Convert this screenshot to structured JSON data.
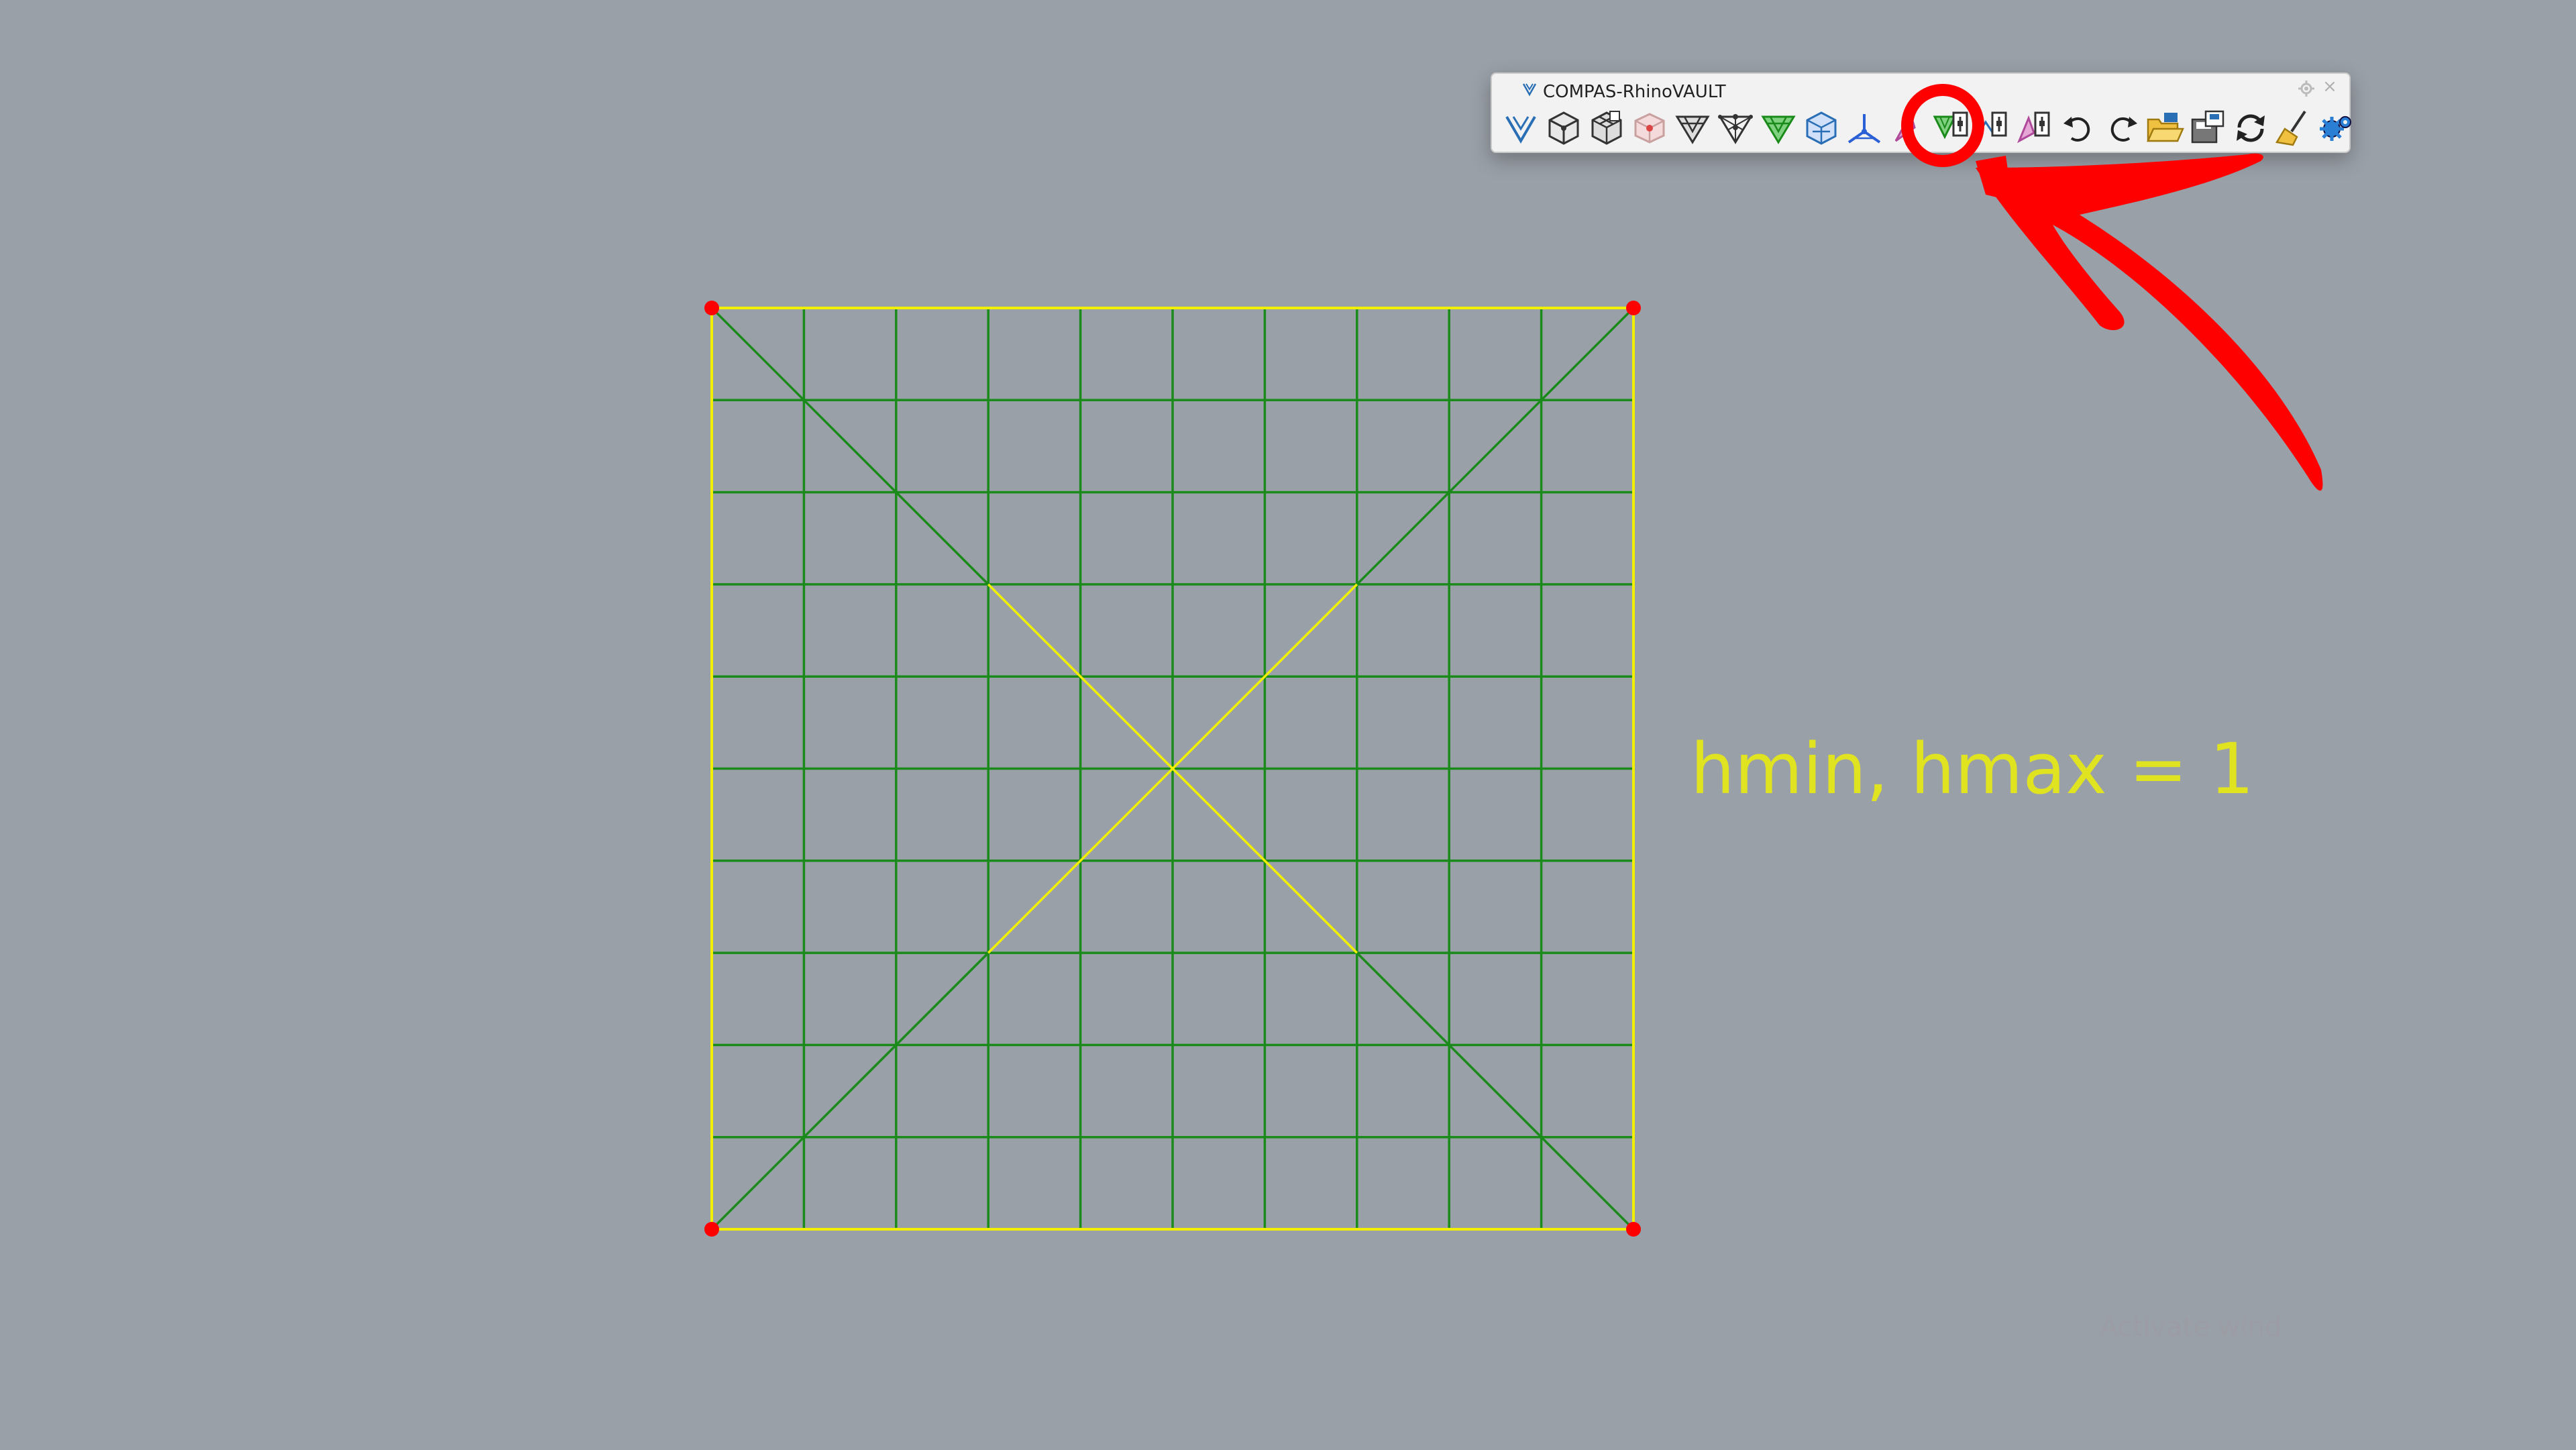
{
  "toolbar": {
    "title": "COMPAS-RhinoVAULT",
    "close_glyph": "×",
    "tools": [
      {
        "name": "rhinovault-logo-tool",
        "icon": "vault-logo-icon"
      },
      {
        "name": "form-diagram-box-tool",
        "icon": "box-icon"
      },
      {
        "name": "form-diagram-box-grid-tool",
        "icon": "box-grid-icon"
      },
      {
        "name": "form-diagram-mesh-tool",
        "icon": "mesh-icon"
      },
      {
        "name": "form-triangle-tool",
        "icon": "triangle-icon"
      },
      {
        "name": "form-dots-tool",
        "icon": "triangle-dots-icon"
      },
      {
        "name": "form-green-triangle-tool",
        "icon": "green-triangle-icon"
      },
      {
        "name": "force-diagram-tool",
        "icon": "force-diagram-icon"
      },
      {
        "name": "thrust-diagram-tool",
        "icon": "thrust-diagram-icon"
      },
      {
        "name": "purple-tool",
        "icon": "purple-leaf-icon"
      },
      {
        "name": "modify-form-tool",
        "icon": "modify-form-icon"
      },
      {
        "name": "modify-force-tool",
        "icon": "modify-force-icon"
      },
      {
        "name": "modify-thrust-tool",
        "icon": "modify-thrust-icon"
      },
      {
        "name": "undo-tool",
        "icon": "undo-icon"
      },
      {
        "name": "redo-tool",
        "icon": "redo-icon"
      },
      {
        "name": "open-file-tool",
        "icon": "folder-open-icon"
      },
      {
        "name": "save-file-tool",
        "icon": "save-icon"
      },
      {
        "name": "reload-tool",
        "icon": "reload-icon"
      },
      {
        "name": "clear-tool",
        "icon": "broom-icon"
      },
      {
        "name": "settings-tool",
        "icon": "gear-icon"
      }
    ]
  },
  "annotation": {
    "label": "hmin, hmax = 1",
    "highlight_color": "#ff0000",
    "highlighted_tool": "modify-form-tool"
  },
  "colors": {
    "background": "#9aa0a8",
    "grid_edge": "#1a8a1a",
    "boundary_edge": "#f0f000",
    "support": "#ff0000",
    "label": "#e0e420"
  },
  "status": {
    "faded_text": "Activate wind"
  }
}
